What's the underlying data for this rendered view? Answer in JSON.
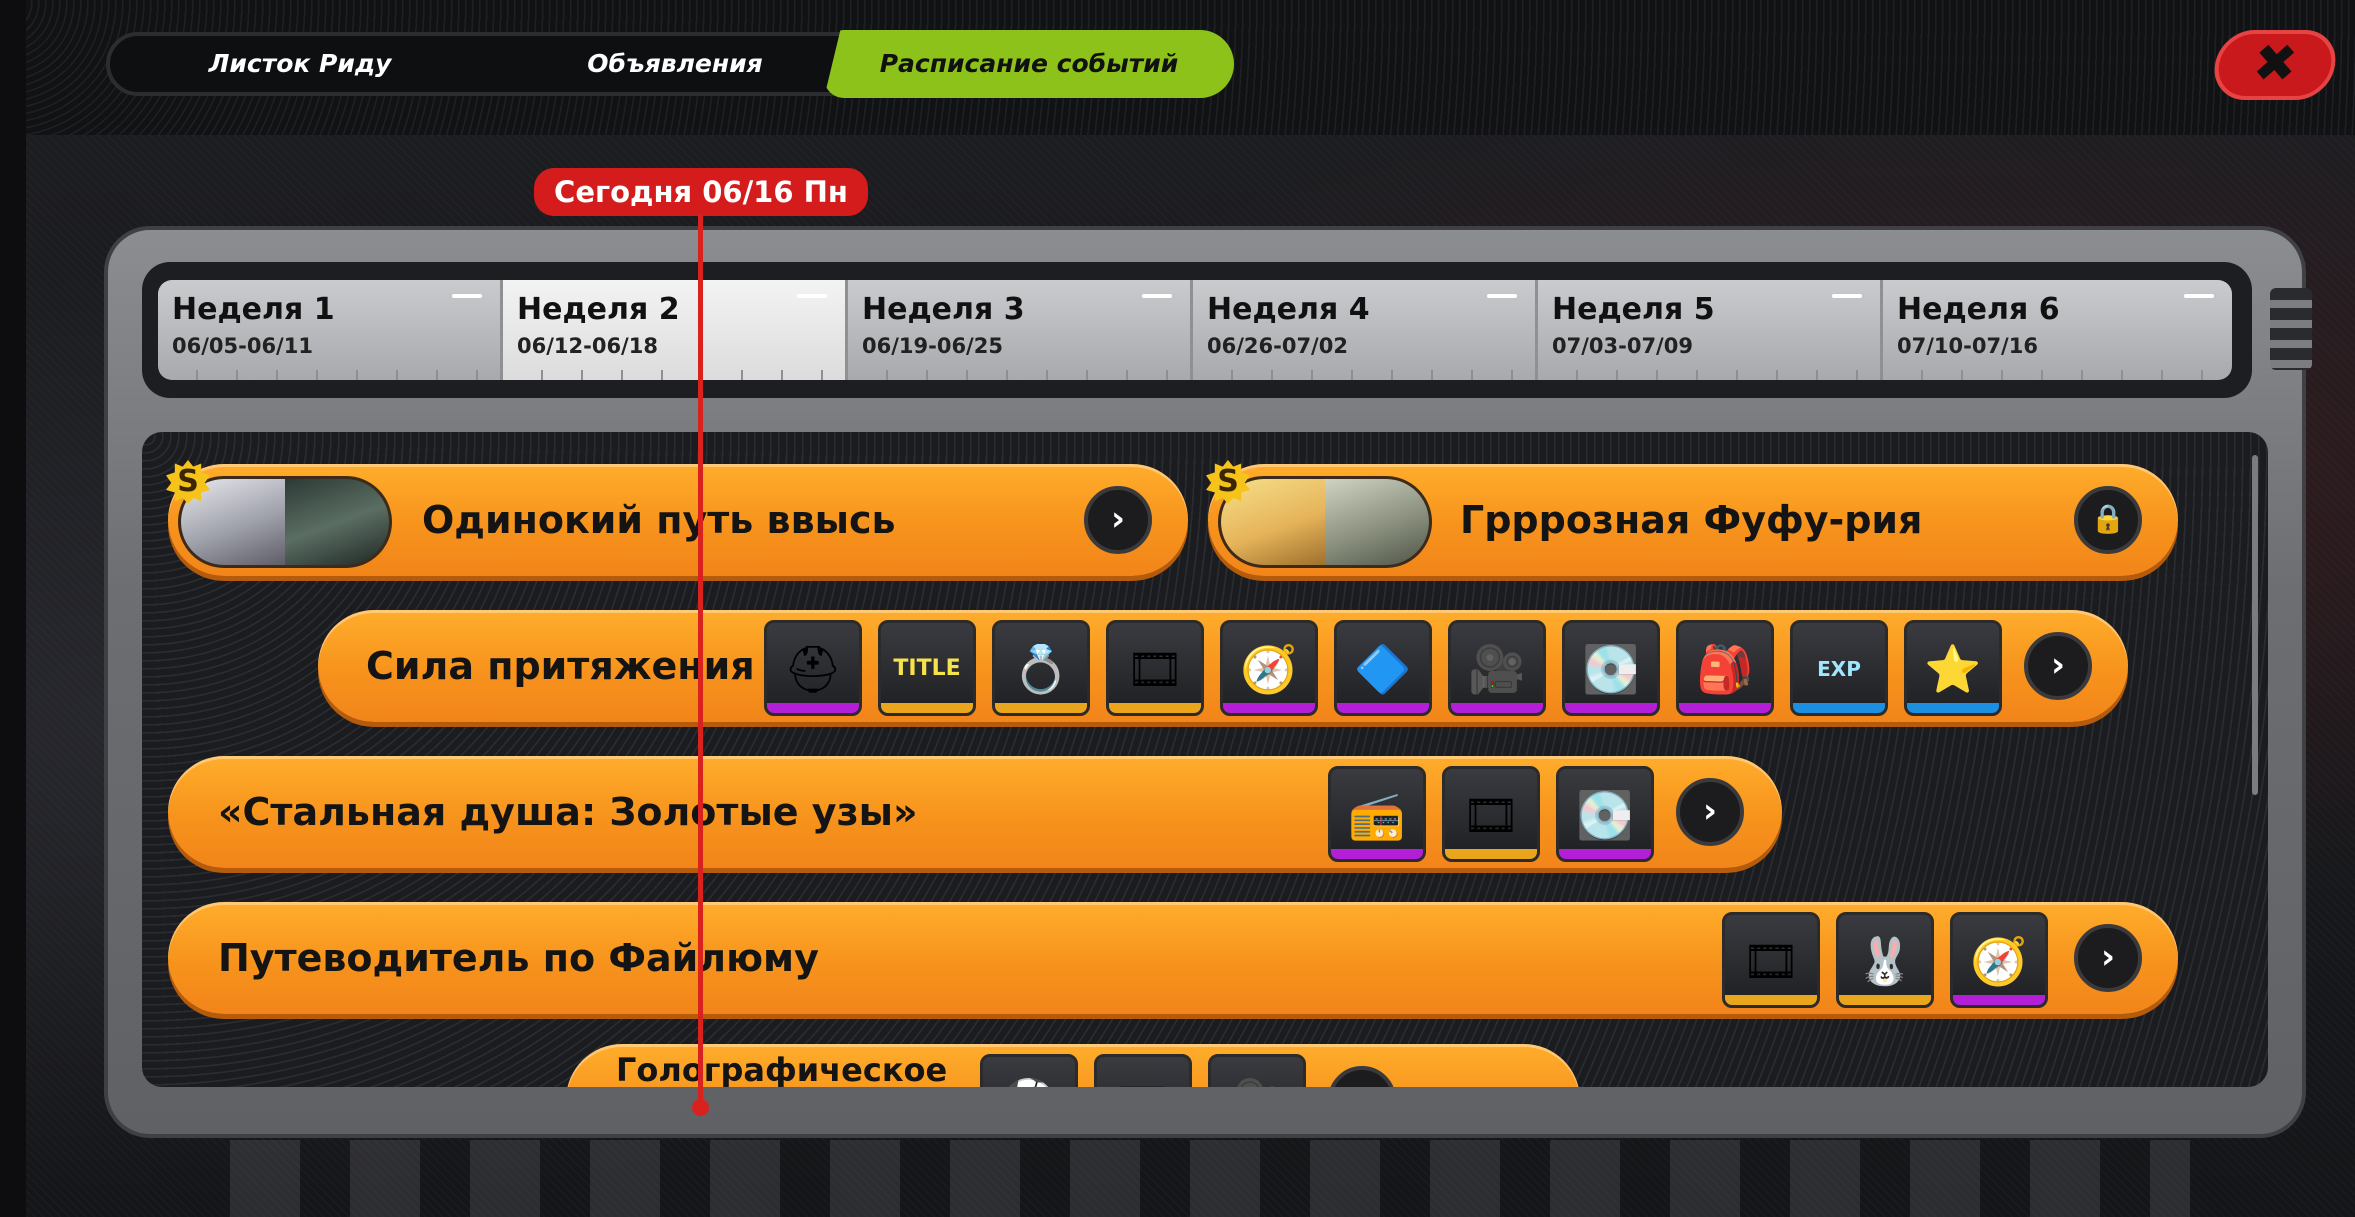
{
  "tabs": [
    {
      "label": "Листок Риду",
      "active": false
    },
    {
      "label": "Объявления",
      "active": false
    },
    {
      "label": "Расписание событий",
      "active": true
    }
  ],
  "close_glyph": "✖",
  "today_label": "Сегодня 06/16 Пн",
  "weeks": [
    {
      "name": "Неделя 1",
      "dates": "06/05-06/11",
      "current": false
    },
    {
      "name": "Неделя 2",
      "dates": "06/12-06/18",
      "current": true
    },
    {
      "name": "Неделя 3",
      "dates": "06/19-06/25",
      "current": false
    },
    {
      "name": "Неделя 4",
      "dates": "06/26-07/02",
      "current": false
    },
    {
      "name": "Неделя 5",
      "dates": "07/03-07/09",
      "current": false
    },
    {
      "name": "Неделя 6",
      "dates": "07/10-07/16",
      "current": false
    }
  ],
  "events": [
    {
      "title": "Одинокий путь ввысь",
      "badge": "S",
      "action": "chevron-right-icon"
    },
    {
      "title": "Грррозная Фуфу-рия",
      "badge": "S",
      "action": "lock-icon"
    },
    {
      "title": "Сила притяжения",
      "action": "chevron-right-icon"
    },
    {
      "title": "«Стальная душа: Золотые узы»",
      "action": "chevron-right-icon"
    },
    {
      "title": "Путеводитель по Файлюму",
      "action": "chevron-right-icon"
    },
    {
      "title": "Голографическое",
      "action": "chevron-right-icon"
    }
  ],
  "icons": {
    "chevron": "›",
    "lock": "🔒"
  },
  "reward_item_labels": {
    "title_item": "TITLE",
    "exp_item": "EXP"
  },
  "colors": {
    "accent": "#8dc21a",
    "event": "#f7931c",
    "today": "#d41c1c",
    "rarity_purple": "#b21fd6",
    "rarity_gold": "#e9a51c",
    "rarity_blue": "#1c8fe0"
  }
}
